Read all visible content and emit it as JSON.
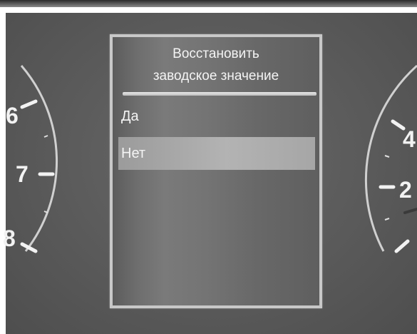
{
  "dialog": {
    "title_line1": "Восстановить",
    "title_line2": "заводское значение",
    "options": [
      {
        "label": "Да",
        "selected": false
      },
      {
        "label": "Нет",
        "selected": true
      }
    ]
  },
  "left_gauge": {
    "labels": [
      "6",
      "7",
      "8"
    ]
  },
  "right_gauge": {
    "labels": [
      "4",
      "2"
    ]
  },
  "colors": {
    "panel": "#5a5a5a",
    "screen_border": "#c8c8c8",
    "highlight": "#b3b3b3",
    "text": "#f4f4f4"
  }
}
